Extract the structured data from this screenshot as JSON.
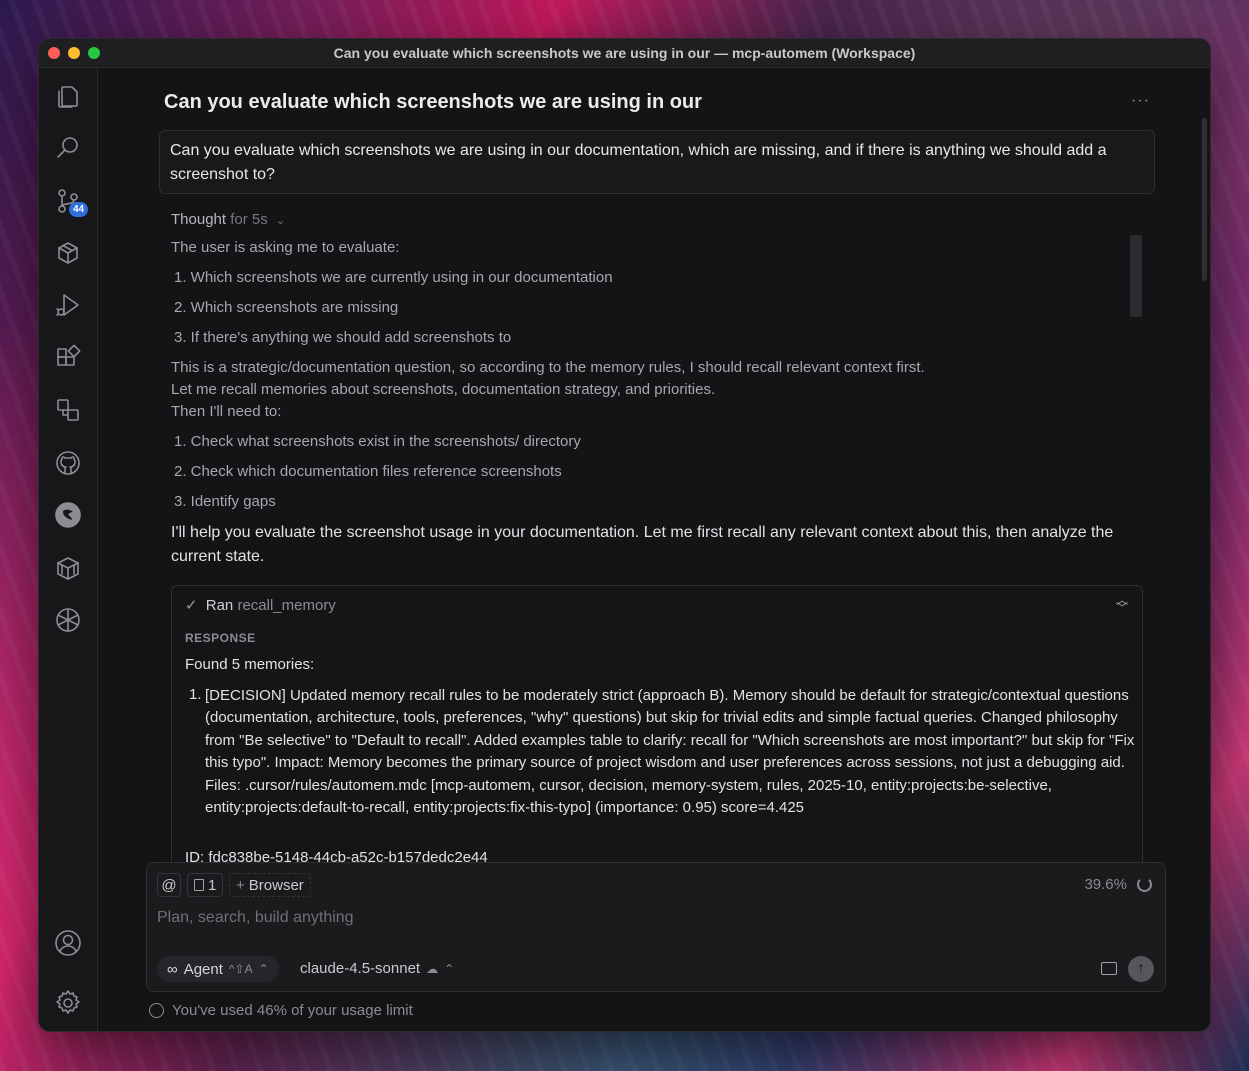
{
  "window": {
    "title": "Can you evaluate which screenshots we are using in our — mcp-automem (Workspace)"
  },
  "activity_bar": {
    "source_control_badge": "44",
    "icons": [
      "files-icon",
      "search-icon",
      "source-control-icon",
      "package-icon",
      "run-debug-icon",
      "extensions-icon",
      "remote-explorer-icon",
      "github-icon",
      "cursor-icon",
      "box-icon",
      "openai-icon",
      "account-icon",
      "settings-gear-icon"
    ]
  },
  "chat": {
    "title": "Can you evaluate which screenshots we are using in our",
    "more_label": "···",
    "user_message": "Can you evaluate which screenshots we are using in our documentation, which are missing, and if there is anything we should add a screenshot to?",
    "thought": {
      "label": "Thought",
      "duration": "for 5s",
      "lines": [
        "The user is asking me to evaluate:",
        "1. Which screenshots we are currently using in our documentation",
        "2. Which screenshots are missing",
        "3. If there's anything we should add screenshots to",
        "This is a strategic/documentation question, so according to the memory rules, I should recall relevant context first.",
        "Let me recall memories about screenshots, documentation strategy, and priorities.",
        "Then I'll need to:",
        "1. Check what screenshots exist in the screenshots/ directory",
        "2. Check which documentation files reference screenshots",
        "3. Identify gaps"
      ]
    },
    "answer": "I'll help you evaluate the screenshot usage in your documentation. Let me first recall any relevant context about this, then analyze the current state.",
    "tool": {
      "status": "Ran",
      "name": "recall_memory",
      "response_label": "RESPONSE",
      "found": "Found 5 memories:",
      "memory_1_num": "1.",
      "memory_1": "[DECISION] Updated memory recall rules to be moderately strict (approach B). Memory should be default for strategic/contextual questions (documentation, architecture, tools, preferences, \"why\" questions) but skip for trivial edits and simple factual queries. Changed philosophy from \"Be selective\" to \"Default to recall\". Added examples table to clarify: recall for \"Which screenshots are most important?\" but skip for \"Fix this typo\". Impact: Memory becomes the primary source of project wisdom and user preferences across sessions, not just a debugging aid. Files: .cursor/rules/automem.mdc [mcp-automem, cursor, decision, memory-system, rules, 2025-10, entity:projects:be-selective, entity:projects:default-to-recall, entity:projects:fix-this-typo] (importance: 0.95) score=4.425",
      "memory_1_id": "ID: fdc838be-5148-44cb-a52c-b157dedc2e44"
    }
  },
  "composer": {
    "mention_label": "@",
    "context_count": "1",
    "browser_label": "Browser",
    "context_percent": "39.6%",
    "placeholder": "Plan, search, build anything",
    "agent_label": "Agent",
    "agent_shortcut": "^⇧A",
    "model_label": "claude-4.5-sonnet"
  },
  "usage_notice": "You've used 46% of your usage limit"
}
